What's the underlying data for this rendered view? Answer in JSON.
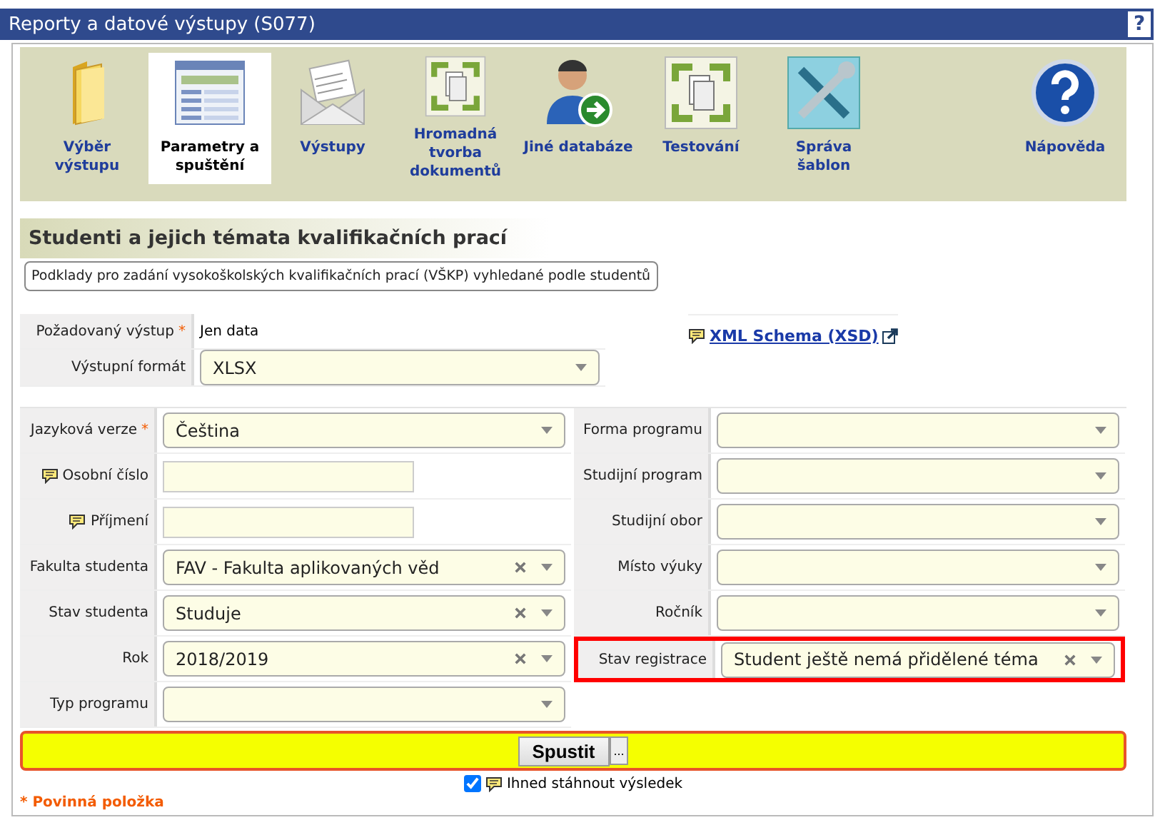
{
  "window": {
    "title": "Reporty a datové výstupy (S077)",
    "help": "?"
  },
  "toolbar": [
    {
      "label": "Výběr výstupu",
      "kind": "folder",
      "selected": false
    },
    {
      "label": "Parametry a spuštění",
      "kind": "form",
      "selected": true
    },
    {
      "label": "Výstupy",
      "kind": "envelope",
      "selected": false
    },
    {
      "label": "Hromadná tvorba dokumentů",
      "kind": "cycle",
      "selected": false
    },
    {
      "label": "Jiné databáze",
      "kind": "person",
      "selected": false
    },
    {
      "label": "Testování",
      "kind": "cycle",
      "selected": false
    },
    {
      "label": "Správa šablon",
      "kind": "tools",
      "selected": false
    },
    {
      "label": "Nápověda",
      "kind": "help",
      "selected": false
    }
  ],
  "section": {
    "title": "Studenti a jejich témata kvalifikačních prací",
    "description": "Podklady pro zadání vysokoškolských kvalifikačních prací (VŠKP) vyhledané podle studentů"
  },
  "output_fields": [
    {
      "label": "Požadovaný výstup",
      "required_mark": "*",
      "kind": "text",
      "value": "Jen data"
    },
    {
      "label": "Výstupní formát",
      "kind": "select",
      "value": "XLSX"
    }
  ],
  "xml_link": "XML Schema (XSD)",
  "left_fields": [
    {
      "label": "Jazyková verze",
      "required_mark": "*",
      "hint": false,
      "kind": "select",
      "value": "Čeština",
      "clearable": false,
      "highlighted": false
    },
    {
      "label": "Osobní číslo",
      "hint": true,
      "kind": "input",
      "highlighted": false
    },
    {
      "label": "Příjmení",
      "hint": true,
      "kind": "input",
      "highlighted": false
    },
    {
      "label": "Fakulta studenta",
      "hint": false,
      "kind": "select",
      "value": "FAV - Fakulta aplikovaných věd",
      "clearable": true,
      "highlighted": false
    },
    {
      "label": "Stav studenta",
      "hint": false,
      "kind": "select",
      "value": "Studuje",
      "clearable": true,
      "highlighted": false
    },
    {
      "label": "Rok",
      "hint": false,
      "kind": "select",
      "value": "2018/2019",
      "clearable": true,
      "highlighted": false
    },
    {
      "label": "Typ programu",
      "hint": false,
      "kind": "select",
      "clearable": false,
      "highlighted": false
    }
  ],
  "right_fields": [
    {
      "label": "Forma programu",
      "hint": false,
      "kind": "select",
      "clearable": false,
      "highlighted": false
    },
    {
      "label": "Studijní program",
      "hint": false,
      "kind": "select",
      "clearable": false,
      "highlighted": false
    },
    {
      "label": "Studijní obor",
      "hint": false,
      "kind": "select",
      "clearable": false,
      "highlighted": false
    },
    {
      "label": "Místo výuky",
      "hint": false,
      "kind": "select",
      "clearable": false,
      "highlighted": false
    },
    {
      "label": "Ročník",
      "hint": false,
      "kind": "select",
      "clearable": false,
      "highlighted": false
    },
    {
      "label": "Stav registrace",
      "hint": false,
      "kind": "select",
      "value": "Student ještě nemá přidělené téma",
      "clearable": true,
      "highlighted": true
    }
  ],
  "run": {
    "button": "Spustit",
    "more": "...",
    "download_label": "Ihned stáhnout výsledek",
    "download_checked": true
  },
  "required_note": "* Povinná položka"
}
